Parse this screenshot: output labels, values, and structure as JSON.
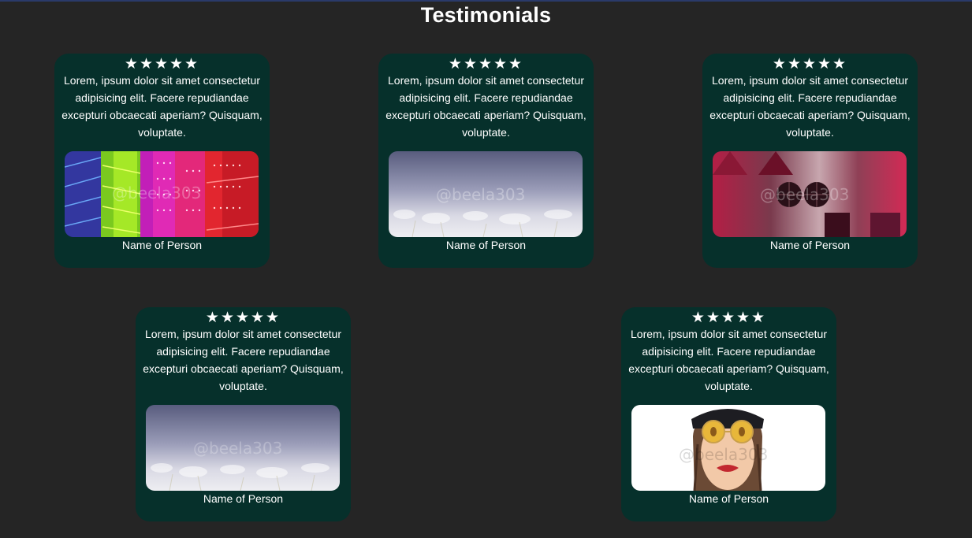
{
  "page": {
    "title": "Testimonials"
  },
  "testimonials": [
    {
      "rating": 5,
      "stars": "★★★★★",
      "text": "Lorem, ipsum dolor sit amet consectetur adipisicing elit. Facere repudiandae excepturi obcaecati aperiam? Quisquam, voluptate.",
      "name": "Name of Person",
      "image_watermark": "@beela303",
      "image": "rainbow-buildings"
    },
    {
      "rating": 5,
      "stars": "★★★★★",
      "text": "Lorem, ipsum dolor sit amet consectetur adipisicing elit. Facere repudiandae excepturi obcaecati aperiam? Quisquam, voluptate.",
      "name": "Name of Person",
      "image_watermark": "@beela303",
      "image": "misty-flowers"
    },
    {
      "rating": 5,
      "stars": "★★★★★",
      "text": "Lorem, ipsum dolor sit amet consectetur adipisicing elit. Facere repudiandae excepturi obcaecati aperiam? Quisquam, voluptate.",
      "name": "Name of Person",
      "image_watermark": "@beela303",
      "image": "abstract-crimson"
    },
    {
      "rating": 5,
      "stars": "★★★★★",
      "text": "Lorem, ipsum dolor sit amet consectetur adipisicing elit. Facere repudiandae excepturi obcaecati aperiam? Quisquam, voluptate.",
      "name": "Name of Person",
      "image_watermark": "@beela303",
      "image": "misty-flowers"
    },
    {
      "rating": 5,
      "stars": "★★★★★",
      "text": "Lorem, ipsum dolor sit amet consectetur adipisicing elit. Facere repudiandae excepturi obcaecati aperiam? Quisquam, voluptate.",
      "name": "Name of Person",
      "image_watermark": "@beela303",
      "image": "woman-sunglasses-illustration"
    }
  ],
  "colors": {
    "background": "#252525",
    "card": "#06302b",
    "text": "#ffffff"
  }
}
